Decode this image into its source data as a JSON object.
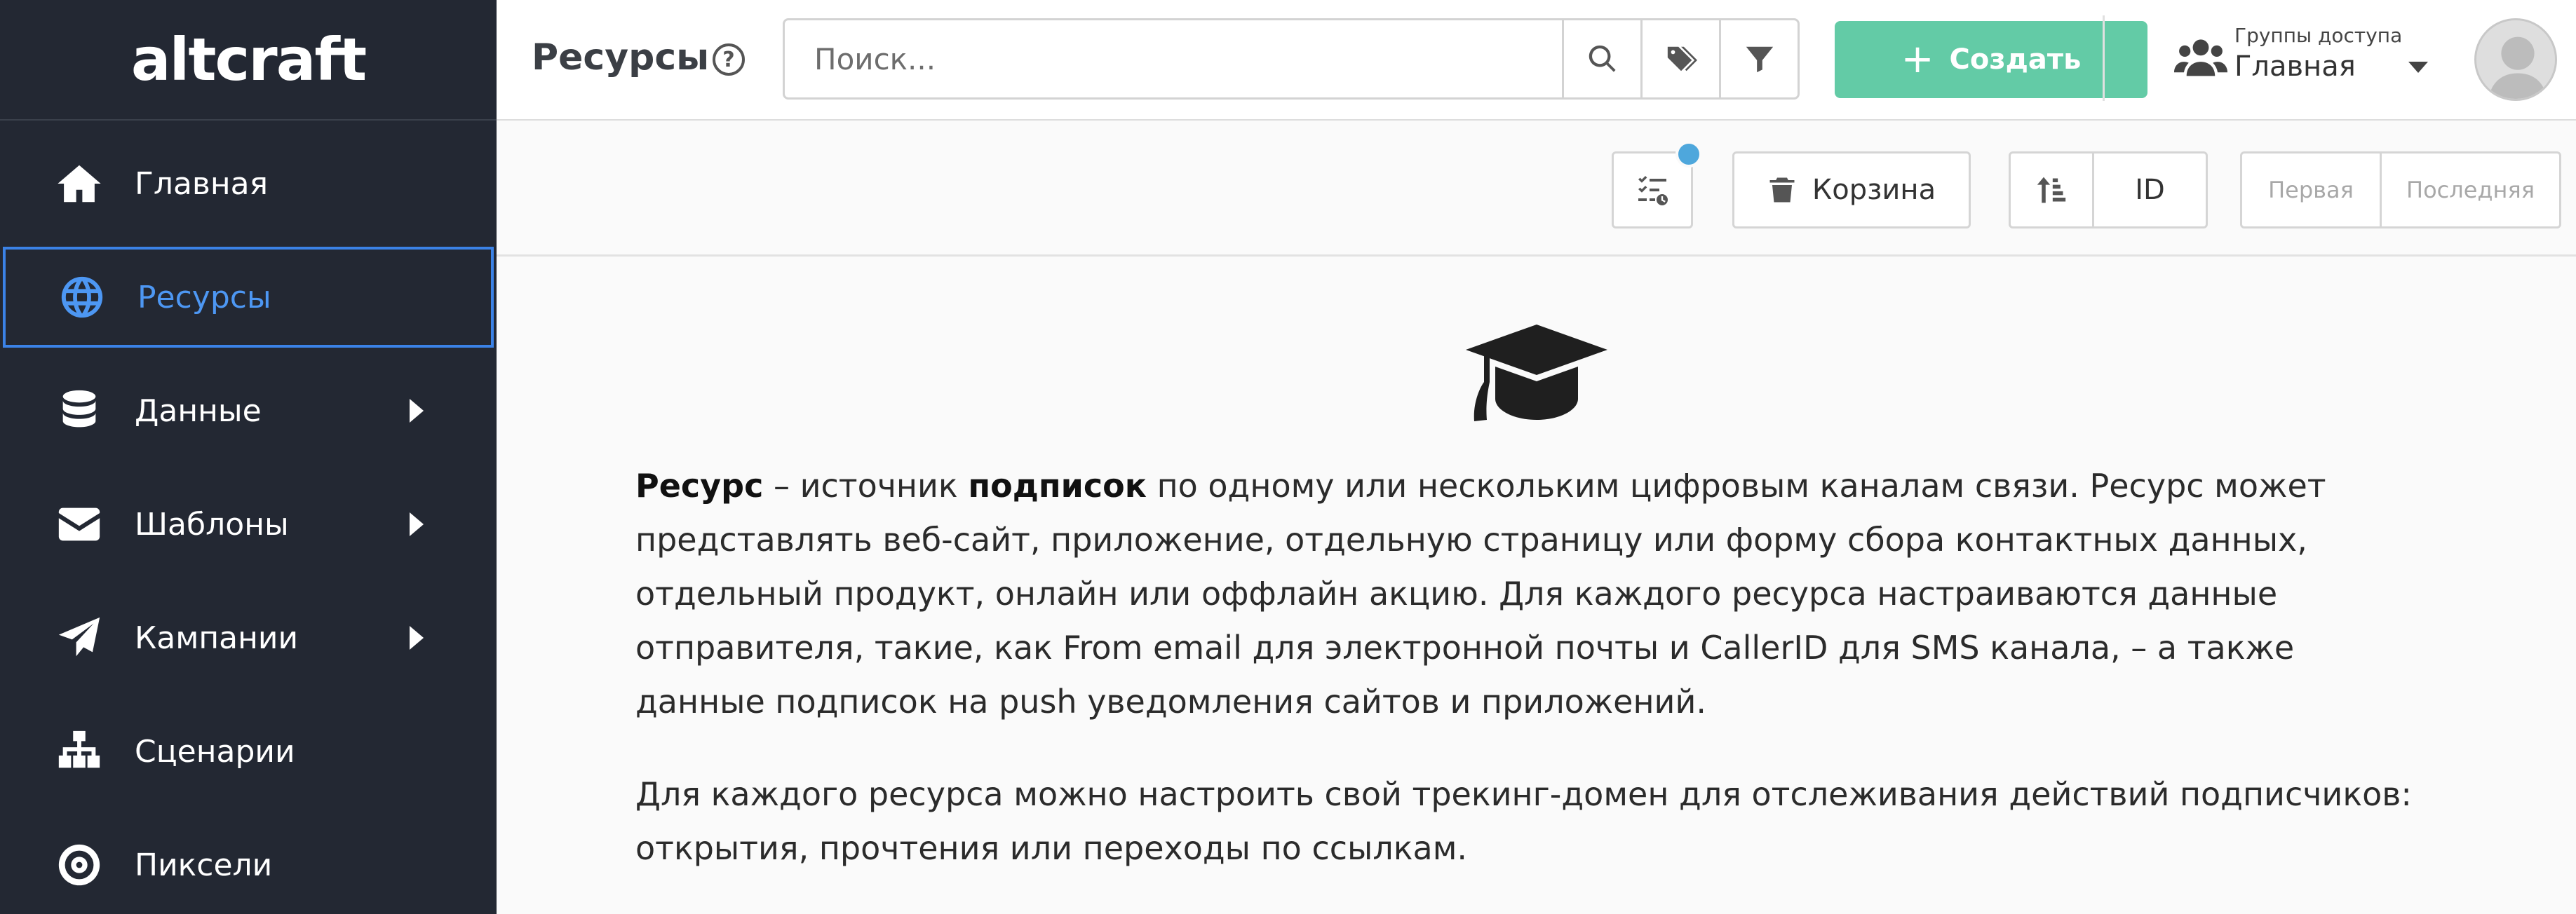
{
  "app": {
    "logo_text": "altcraft"
  },
  "sidebar": {
    "items": [
      {
        "label": "Главная",
        "icon": "home-icon",
        "active": false,
        "has_submenu": false
      },
      {
        "label": "Ресурсы",
        "icon": "globe-icon",
        "active": true,
        "has_submenu": false
      },
      {
        "label": "Данные",
        "icon": "database-icon",
        "active": false,
        "has_submenu": true
      },
      {
        "label": "Шаблоны",
        "icon": "envelope-icon",
        "active": false,
        "has_submenu": true
      },
      {
        "label": "Кампании",
        "icon": "paper-plane-icon",
        "active": false,
        "has_submenu": true
      },
      {
        "label": "Сценарии",
        "icon": "sitemap-icon",
        "active": false,
        "has_submenu": false
      },
      {
        "label": "Пиксели",
        "icon": "target-icon",
        "active": false,
        "has_submenu": false
      }
    ]
  },
  "header": {
    "title": "Ресурсы",
    "help_glyph": "?",
    "search": {
      "placeholder": "Поиск...",
      "value": ""
    },
    "create_button": {
      "plus": "+",
      "label": "Создать"
    },
    "access_groups": {
      "caption": "Группы доступа",
      "value": "Главная"
    }
  },
  "toolbar": {
    "trash_label": "Корзина",
    "sort_field": "ID",
    "pagination": {
      "first": "Первая",
      "last": "Последняя"
    }
  },
  "content": {
    "paragraph1": {
      "term": "Ресурс",
      "part_a": " – источник ",
      "bold": "подписок",
      "part_b": " по одному или нескольким цифровым каналам связи. Ресурс может представлять веб-сайт, приложение, отдельную страницу или форму сбора контактных данных, отдельный продукт, онлайн или оффлайн акцию. Для каждого ресурса настраиваются данные отправителя, такие, как From email для электронной почты и CallerID для SMS канала, – а также данные подписок на push уведомления сайтов и приложений."
    },
    "paragraph2": "Для каждого ресурса можно настроить свой трекинг-домен для отслеживания действий подписчиков: открытия, прочтения или переходы по ссылкам."
  },
  "colors": {
    "sidebar_bg": "#232833",
    "active_accent": "#4d97f3",
    "create_button": "#63cba6",
    "badge": "#4ea7dc"
  }
}
